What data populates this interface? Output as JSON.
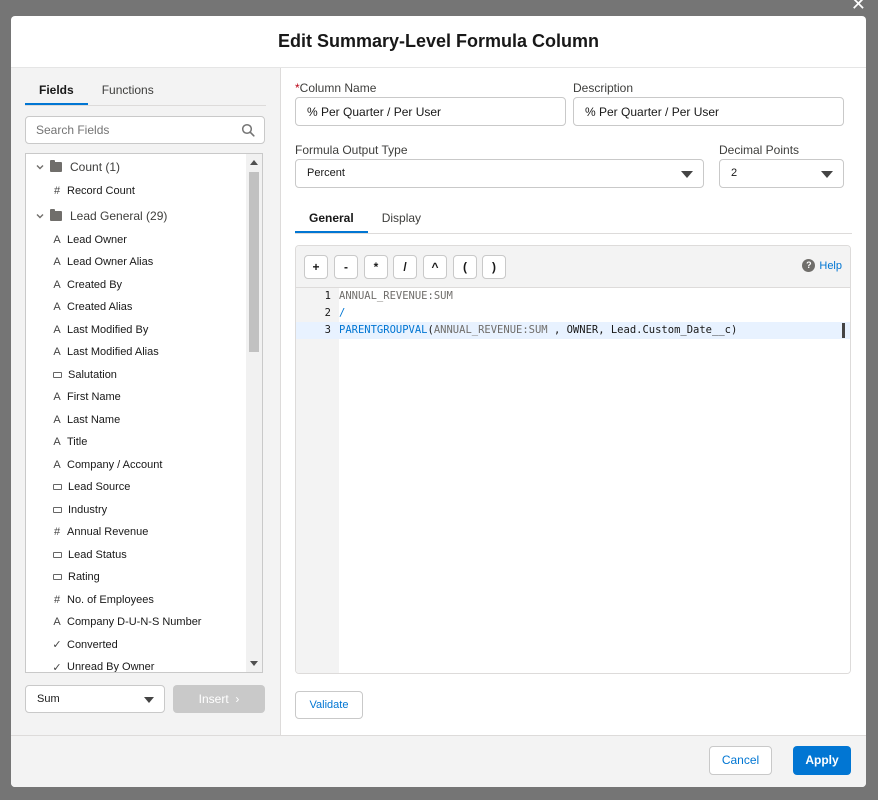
{
  "modal": {
    "title": "Edit Summary-Level Formula Column"
  },
  "left": {
    "tabs": [
      {
        "label": "Fields"
      },
      {
        "label": "Functions"
      }
    ],
    "search_placeholder": "Search Fields",
    "groups": [
      {
        "label": "Count (1)",
        "fields": [
          {
            "label": "Record Count",
            "type": "number"
          }
        ]
      },
      {
        "label": "Lead General (29)",
        "fields": [
          {
            "label": "Lead Owner",
            "type": "text"
          },
          {
            "label": "Lead Owner Alias",
            "type": "text"
          },
          {
            "label": "Created By",
            "type": "text"
          },
          {
            "label": "Created Alias",
            "type": "text"
          },
          {
            "label": "Last Modified By",
            "type": "text"
          },
          {
            "label": "Last Modified Alias",
            "type": "text"
          },
          {
            "label": "Salutation",
            "type": "picklist"
          },
          {
            "label": "First Name",
            "type": "text"
          },
          {
            "label": "Last Name",
            "type": "text"
          },
          {
            "label": "Title",
            "type": "text"
          },
          {
            "label": "Company / Account",
            "type": "text"
          },
          {
            "label": "Lead Source",
            "type": "picklist"
          },
          {
            "label": "Industry",
            "type": "picklist"
          },
          {
            "label": "Annual Revenue",
            "type": "number"
          },
          {
            "label": "Lead Status",
            "type": "picklist"
          },
          {
            "label": "Rating",
            "type": "picklist"
          },
          {
            "label": "No. of Employees",
            "type": "number"
          },
          {
            "label": "Company D-U-N-S Number",
            "type": "text"
          },
          {
            "label": "Converted",
            "type": "checkbox"
          },
          {
            "label": "Unread By Owner",
            "type": "checkbox"
          }
        ]
      }
    ],
    "aggregate_value": "Sum",
    "insert_label": "Insert"
  },
  "form": {
    "column_name_label": "Column Name",
    "column_name_value": "% Per Quarter / Per User",
    "description_label": "Description",
    "description_value": "% Per Quarter / Per User",
    "output_type_label": "Formula Output Type",
    "output_type_value": "Percent",
    "decimal_label": "Decimal Points",
    "decimal_value": "2"
  },
  "editor": {
    "tabs": [
      {
        "label": "General"
      },
      {
        "label": "Display"
      }
    ],
    "operators": [
      "+",
      "-",
      "*",
      "/",
      "^",
      "(",
      ")"
    ],
    "help_label": "Help",
    "lines": [
      {
        "num": "1",
        "text": "ANNUAL_REVENUE:SUM"
      },
      {
        "num": "2",
        "text": "/"
      },
      {
        "num": "3",
        "fn": "PARENTGROUPVAL",
        "open": "(",
        "arg": "ANNUAL_REVENUE:SUM",
        "rest": " , OWNER, Lead.Custom_Date__c)"
      }
    ],
    "validate_label": "Validate"
  },
  "footer": {
    "cancel_label": "Cancel",
    "apply_label": "Apply"
  }
}
